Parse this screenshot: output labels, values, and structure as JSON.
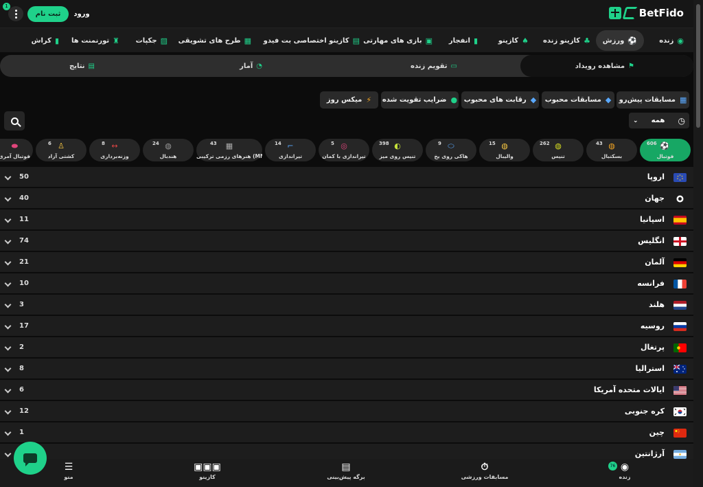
{
  "header": {
    "brand": "BetFido",
    "menu_badge": "1",
    "register_label": "ثبت نام",
    "login_label": "ورود"
  },
  "main_nav": [
    {
      "label": "زنده",
      "icon": "live-icon"
    },
    {
      "label": "ورزش",
      "icon": "football-icon",
      "active": true
    },
    {
      "label": "کازینو زنده",
      "icon": "dealer-icon"
    },
    {
      "label": "کازینو",
      "icon": "cherry-icon"
    },
    {
      "label": "انفجار",
      "icon": "chart-icon"
    },
    {
      "label": "بازی های مهارتی",
      "icon": "dice-icon"
    },
    {
      "label": "کازینو اختصاصی بت فیدو",
      "icon": "screen-icon"
    },
    {
      "label": "طرح های تشویقی",
      "icon": "gift-icon"
    },
    {
      "label": "جکپات",
      "icon": "cart-icon"
    },
    {
      "label": "تورنمنت ها",
      "icon": "trophy-icon"
    },
    {
      "label": "کراش",
      "icon": "chart-icon"
    }
  ],
  "sub_nav": [
    {
      "label": "مشاهده رویداد",
      "icon": "event-icon",
      "active": true
    },
    {
      "label": "تقویم زنده",
      "icon": "calendar-icon"
    },
    {
      "label": "آمار",
      "icon": "pie-icon"
    },
    {
      "label": "نتایج",
      "icon": "results-icon"
    }
  ],
  "filters": [
    {
      "label": "مسابقات پیش‌رو",
      "icon": "calendar-clock-icon",
      "color": "#5aa9ff"
    },
    {
      "label": "مسابقات محبوب",
      "icon": "diamond-icon",
      "color": "#5aa9ff"
    },
    {
      "label": "رقابت های محبوب",
      "icon": "diamond-icon",
      "color": "#5aa9ff"
    },
    {
      "label": "ضرایب تقویت شده",
      "icon": "boost-icon",
      "color": "#1fd18a"
    },
    {
      "label": "میکس روز",
      "icon": "bolt-icon",
      "color": "#f5a623"
    }
  ],
  "time_filter": {
    "value": "همه"
  },
  "sports": [
    {
      "label": "فوتبال",
      "count": "606",
      "icon": "football-icon",
      "active": true
    },
    {
      "label": "بسکتبال",
      "count": "43",
      "icon": "basketball-icon"
    },
    {
      "label": "تنیس",
      "count": "262",
      "icon": "tennis-icon"
    },
    {
      "label": "والیبال",
      "count": "15",
      "icon": "volleyball-icon"
    },
    {
      "label": "هاکی روی یخ",
      "count": "9",
      "icon": "hockey-icon"
    },
    {
      "label": "تنیس روی میز",
      "count": "398",
      "icon": "table-tennis-icon"
    },
    {
      "label": "تیراندازی با کمان",
      "count": "5",
      "icon": "archery-icon"
    },
    {
      "label": "تیراندازی",
      "count": "14",
      "icon": "shooting-icon"
    },
    {
      "label": "هنرهای رزمی ترکیبی (MMA)",
      "count": "43",
      "icon": "mma-icon"
    },
    {
      "label": "هندبال",
      "count": "24",
      "icon": "handball-icon"
    },
    {
      "label": "وزنه‌برداری",
      "count": "8",
      "icon": "weightlifting-icon"
    },
    {
      "label": "کشتی آزاد",
      "count": "6",
      "icon": "wrestling-icon"
    },
    {
      "label": "فوتبال آمری",
      "count": "",
      "icon": "american-football-icon"
    }
  ],
  "countries": [
    {
      "name": "اروپا",
      "count": "50",
      "flag": "eu-flag-icon"
    },
    {
      "name": "جهان",
      "count": "40",
      "flag": "globe-icon"
    },
    {
      "name": "اسپانیا",
      "count": "11",
      "flag": "spain-flag-icon"
    },
    {
      "name": "انگلیس",
      "count": "74",
      "flag": "england-flag-icon"
    },
    {
      "name": "آلمان",
      "count": "21",
      "flag": "germany-flag-icon"
    },
    {
      "name": "فرانسه",
      "count": "10",
      "flag": "france-flag-icon"
    },
    {
      "name": "هلند",
      "count": "3",
      "flag": "netherlands-flag-icon"
    },
    {
      "name": "روسیه",
      "count": "17",
      "flag": "russia-flag-icon"
    },
    {
      "name": "پرتغال",
      "count": "2",
      "flag": "portugal-flag-icon"
    },
    {
      "name": "استرالیا",
      "count": "8",
      "flag": "australia-flag-icon"
    },
    {
      "name": "ایالات متحده آمریکا",
      "count": "6",
      "flag": "usa-flag-icon"
    },
    {
      "name": "کره جنوبی",
      "count": "12",
      "flag": "south-korea-flag-icon"
    },
    {
      "name": "چین",
      "count": "1",
      "flag": "china-flag-icon"
    },
    {
      "name": "آرژانتین",
      "count": "",
      "flag": "argentina-flag-icon"
    }
  ],
  "bottom_nav": [
    {
      "label": "زنده",
      "icon": "live-icon",
      "badge": "76"
    },
    {
      "label": "مسابقات ورزشی",
      "icon": "stopwatch-icon"
    },
    {
      "label": "برگه پیش‌بینی",
      "icon": "betslip-icon"
    },
    {
      "label": "کازینو",
      "icon": "slots-icon"
    },
    {
      "label": "منو",
      "icon": "hamburger-icon"
    }
  ],
  "colors": {
    "accent": "#1fd18a",
    "background": "#0c0c0c",
    "row": "#1d1d1d"
  }
}
